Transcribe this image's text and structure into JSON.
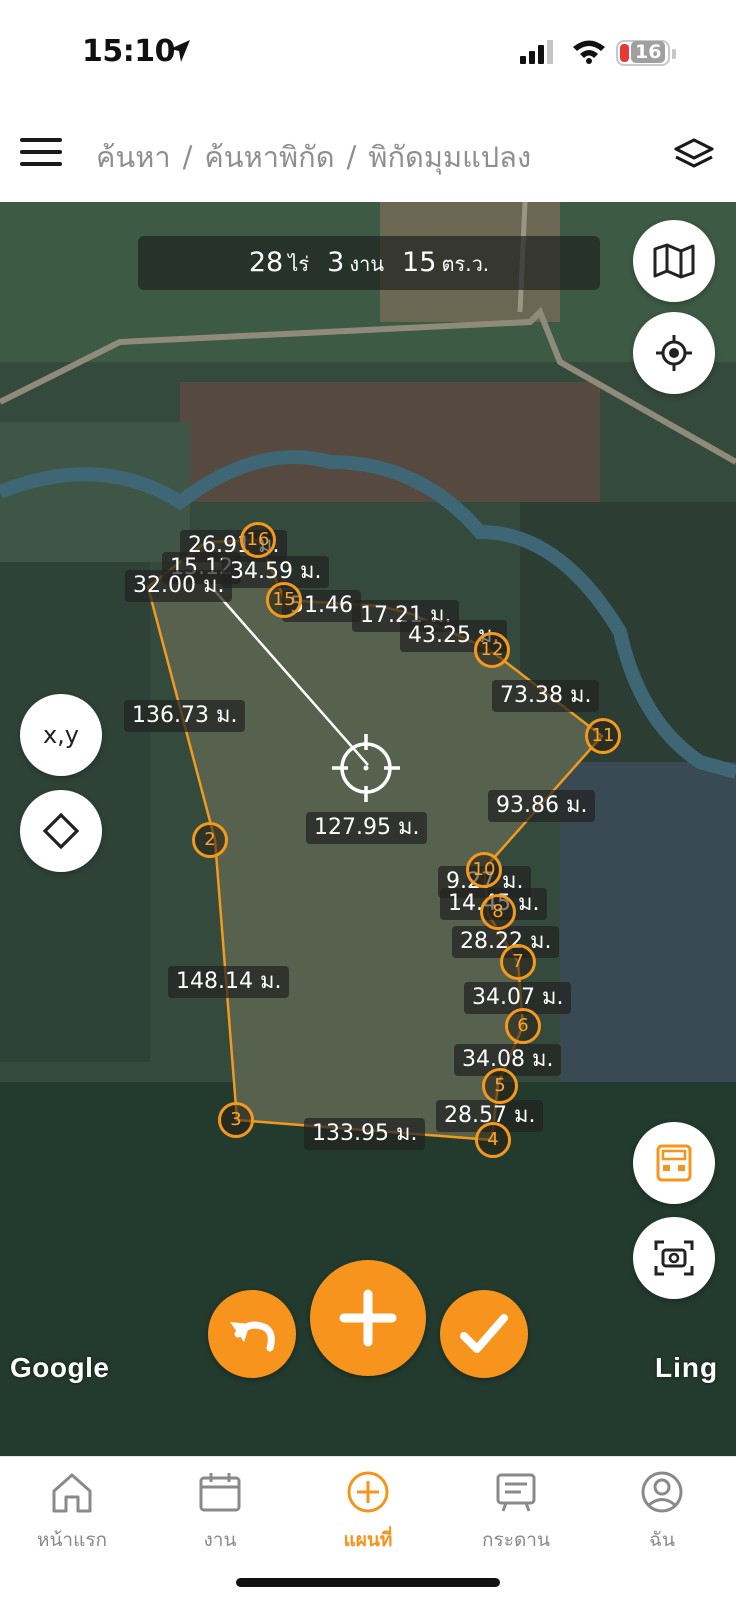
{
  "status_bar": {
    "time": "15:10",
    "battery": "16"
  },
  "header": {
    "breadcrumb": [
      "ค้นหา",
      "ค้นหาพิกัด",
      "พิกัดมุมแปลง"
    ],
    "separator": "/"
  },
  "map": {
    "area": {
      "rai_value": "28",
      "rai_unit": "ไร่",
      "ngan_value": "3",
      "ngan_unit": "งาน",
      "wa_value": "15",
      "wa_unit": "ตร.ว."
    },
    "buttons": {
      "xy_label": "x,y"
    },
    "segment_labels": [
      "26.91 ม.",
      "15.12",
      "34.59 ม.",
      "32.00 ม.",
      "51.46",
      "17.21 ม.",
      "43.25 ม.",
      "73.38 ม.",
      "136.73 ม.",
      "93.86 ม.",
      "127.95 ม.",
      "9.27 ม.",
      "14.45 ม.",
      "28.22 ม.",
      "148.14 ม.",
      "34.07 ม.",
      "34.08 ม.",
      "28.57 ม.",
      "133.95 ม."
    ],
    "vertices": [
      "2",
      "3",
      "4",
      "5",
      "6",
      "7",
      "8",
      "10",
      "11",
      "12",
      "15",
      "16"
    ],
    "attribution_left": "Google",
    "attribution_right": "Ling",
    "accent_color": "#f7941d"
  },
  "tabbar": {
    "tabs": [
      {
        "label": "หน้าแรก",
        "icon": "home-icon"
      },
      {
        "label": "งาน",
        "icon": "calendar-icon"
      },
      {
        "label": "แผนที่",
        "icon": "plus-circle-icon",
        "active": true
      },
      {
        "label": "กระดาน",
        "icon": "board-icon"
      },
      {
        "label": "ฉัน",
        "icon": "profile-icon"
      }
    ]
  }
}
